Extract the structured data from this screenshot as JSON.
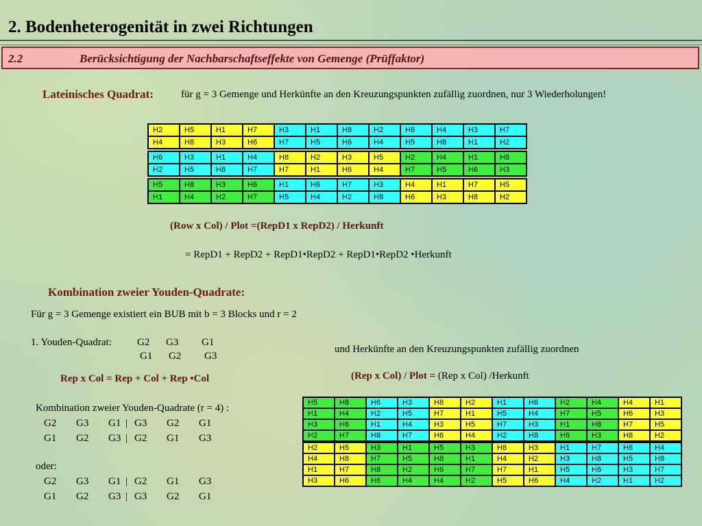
{
  "title": "2. Bodenheterogenität in zwei Richtungen",
  "subheader": {
    "number": "2.2",
    "text": "Berücksichtigung der Nachbarschaftseffekte von Gemenge (Prüffaktor)"
  },
  "latin_square": {
    "label": "Lateinisches Quadrat:",
    "description": "für g = 3 Gemenge und Herkünfte an den Kreuzungspunkten zufällig zuordnen, nur 3 Wiederholungen!",
    "rows": [
      [
        "H2",
        "H5",
        "H1",
        "H7",
        "H3",
        "H1",
        "H8",
        "H2",
        "H6",
        "H4",
        "H3",
        "H7"
      ],
      [
        "H4",
        "H8",
        "H3",
        "H6",
        "H7",
        "H5",
        "H6",
        "H4",
        "H5",
        "H8",
        "H1",
        "H2"
      ],
      [
        "H6",
        "H3",
        "H1",
        "H4",
        "H8",
        "H2",
        "H3",
        "H5",
        "H2",
        "H4",
        "H1",
        "H8"
      ],
      [
        "H2",
        "H5",
        "H8",
        "H7",
        "H7",
        "H1",
        "H6",
        "H4",
        "H7",
        "H5",
        "H6",
        "H3"
      ],
      [
        "H5",
        "H8",
        "H3",
        "H6",
        "H1",
        "H6",
        "H7",
        "H3",
        "H4",
        "H1",
        "H7",
        "H5"
      ],
      [
        "H1",
        "H4",
        "H2",
        "H7",
        "H5",
        "H4",
        "H2",
        "H8",
        "H6",
        "H3",
        "H8",
        "H2"
      ]
    ],
    "block_colors": [
      [
        "y",
        "c",
        "c"
      ],
      [
        "c",
        "y",
        "g"
      ],
      [
        "g",
        "c",
        "y"
      ]
    ],
    "formula1": "(Row x Col) / Plot =(RepD1 x RepD2) / Herkunft",
    "formula2": "= RepD1 +  RepD2 + RepD1•RepD2 + RepD1•RepD2 •Herkunft"
  },
  "youden": {
    "heading": "Kombination zweier Youden-Quadrate:",
    "bub_text": "Für g = 3 Gemenge existiert ein BUB mit b = 3 Blocks  und  r = 2",
    "y1_label": "1. Youden-Quadrat:",
    "y1_row1": [
      "G2",
      "G3",
      "G1"
    ],
    "y1_row2": [
      "G1",
      "G2",
      "G3"
    ],
    "assign_text": "und Herkünfte an den Kreuzungspunkten zufällig zuordnen",
    "formula_left": "Rep x Col = Rep + Col + Rep •Col",
    "formula_right_bold": "(Rep x Col) / Plot =",
    "formula_right_rest": " (Rep x Col) /Herkunft",
    "combo_title": "Kombination zweier Youden-Quadrate (r = 4) :",
    "combo_rows": [
      [
        [
          "G2",
          "G3",
          "G1"
        ],
        [
          "G3",
          "G2",
          "G1"
        ]
      ],
      [
        [
          "G1",
          "G2",
          "G3"
        ],
        [
          "G2",
          "G1",
          "G3"
        ]
      ]
    ],
    "oder": "oder:",
    "oder_rows": [
      [
        [
          "G2",
          "G3",
          "G1"
        ],
        [
          "G2",
          "G1",
          "G3"
        ]
      ],
      [
        [
          "G1",
          "G2",
          "G3"
        ],
        [
          "G3",
          "G2",
          "G1"
        ]
      ]
    ],
    "grid_rows": [
      [
        "H5",
        "H8",
        "H6",
        "H3",
        "H8",
        "H2",
        "H1",
        "H6",
        "H2",
        "H4",
        "H4",
        "H1"
      ],
      [
        "H1",
        "H4",
        "H2",
        "H5",
        "H7",
        "H1",
        "H5",
        "H4",
        "H7",
        "H5",
        "H6",
        "H3"
      ],
      [
        "H3",
        "H6",
        "H1",
        "H4",
        "H3",
        "H5",
        "H7",
        "H3",
        "H1",
        "H8",
        "H7",
        "H5"
      ],
      [
        "H2",
        "H7",
        "H8",
        "H7",
        "H6",
        "H4",
        "H2",
        "H8",
        "H6",
        "H3",
        "H8",
        "H2"
      ],
      [
        "H2",
        "H5",
        "H3",
        "H1",
        "H5",
        "H3",
        "H8",
        "H3",
        "H1",
        "H7",
        "H6",
        "H4"
      ],
      [
        "H4",
        "H8",
        "H7",
        "H5",
        "H8",
        "H1",
        "H4",
        "H2",
        "H3",
        "H8",
        "H5",
        "H8"
      ],
      [
        "H1",
        "H7",
        "H8",
        "H2",
        "H6",
        "H7",
        "H7",
        "H1",
        "H5",
        "H6",
        "H3",
        "H7"
      ],
      [
        "H3",
        "H6",
        "H6",
        "H4",
        "H4",
        "H2",
        "H5",
        "H6",
        "H4",
        "H2",
        "H1",
        "H2"
      ]
    ],
    "block_colors": [
      [
        "g",
        "c",
        "y",
        "c",
        "g",
        "y"
      ],
      [
        "y",
        "g",
        "g",
        "y",
        "c",
        "c"
      ]
    ]
  }
}
